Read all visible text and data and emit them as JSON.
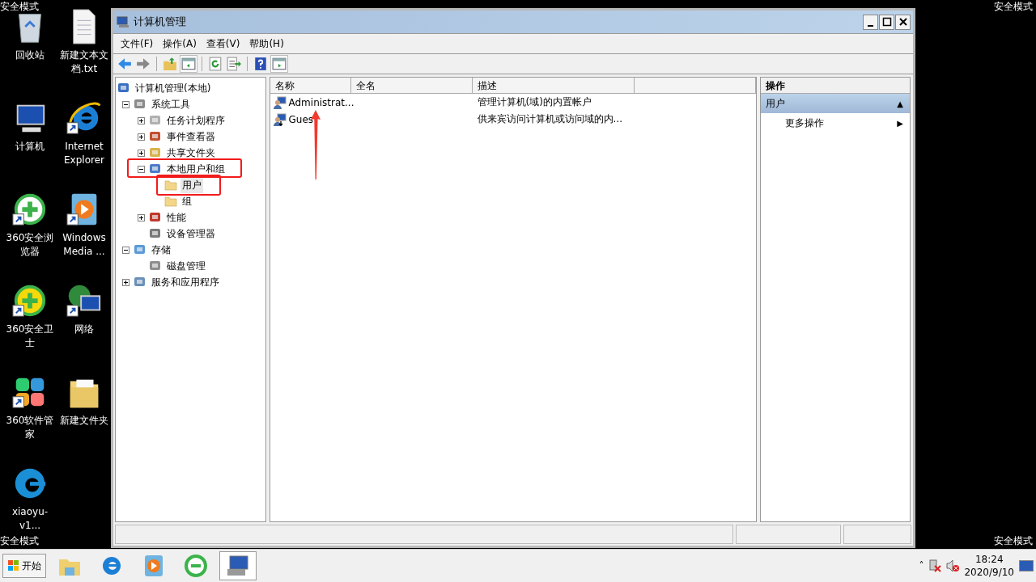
{
  "safe_mode_labels": [
    "安全模式",
    "安全模式",
    "安全模式",
    "安全模式"
  ],
  "desktop_icons": [
    {
      "label": "回收站",
      "kind": "recycle",
      "shortcut": false
    },
    {
      "label": "新建文本文档.txt",
      "kind": "document",
      "shortcut": false
    },
    {
      "label": "计算机",
      "kind": "computer",
      "shortcut": false
    },
    {
      "label": "Internet Explorer",
      "kind": "ie",
      "shortcut": true
    },
    {
      "label": "360安全浏览器",
      "kind": "browser360",
      "shortcut": true
    },
    {
      "label": "Windows Media ...",
      "kind": "media",
      "shortcut": true
    },
    {
      "label": "360安全卫士",
      "kind": "guard360",
      "shortcut": true
    },
    {
      "label": "网络",
      "kind": "network",
      "shortcut": true
    },
    {
      "label": "360软件管家",
      "kind": "soft360",
      "shortcut": true
    },
    {
      "label": "新建文件夹",
      "kind": "folder",
      "shortcut": false
    },
    {
      "label": "xiaoyu-v1...",
      "kind": "edge",
      "shortcut": false
    }
  ],
  "window": {
    "title": "计算机管理",
    "menu": [
      "文件(F)",
      "操作(A)",
      "查看(V)",
      "帮助(H)"
    ],
    "tree": [
      {
        "label": "计算机管理(本地)",
        "kind": "computer",
        "selected": false,
        "children": [
          {
            "label": "系统工具",
            "kind": "tools",
            "expanded": true,
            "selected": false,
            "children": [
              {
                "label": "任务计划程序",
                "kind": "clock",
                "expanded": false,
                "selected": false
              },
              {
                "label": "事件查看器",
                "kind": "event",
                "expanded": false,
                "selected": false
              },
              {
                "label": "共享文件夹",
                "kind": "share",
                "expanded": false,
                "selected": false
              },
              {
                "label": "本地用户和组",
                "kind": "users",
                "expanded": true,
                "selected": false,
                "children": [
                  {
                    "label": "用户",
                    "kind": "folder",
                    "selected": true
                  },
                  {
                    "label": "组",
                    "kind": "folder",
                    "selected": false
                  }
                ]
              },
              {
                "label": "性能",
                "kind": "perf",
                "expanded": false,
                "selected": false
              },
              {
                "label": "设备管理器",
                "kind": "device",
                "selected": false
              }
            ]
          },
          {
            "label": "存储",
            "kind": "storage",
            "expanded": true,
            "selected": false,
            "children": [
              {
                "label": "磁盘管理",
                "kind": "disk",
                "selected": false
              }
            ]
          },
          {
            "label": "服务和应用程序",
            "kind": "services",
            "expanded": false,
            "selected": false
          }
        ]
      }
    ],
    "columns": [
      "名称",
      "全名",
      "描述"
    ],
    "rows": [
      {
        "name": "Administrat...",
        "description": "管理计算机(域)的内置帐户",
        "kind": "admin"
      },
      {
        "name": "Gues",
        "description": "供来宾访问计算机或访问域的内...",
        "kind": "guest"
      }
    ],
    "actions": {
      "header": "操作",
      "section": {
        "label": "用户",
        "expanded": true,
        "toggle": "▲"
      },
      "items": [
        {
          "label": "更多操作",
          "arrow": "▶"
        }
      ]
    }
  },
  "taskbar": {
    "start": "开始",
    "apps": [
      {
        "kind": "explorer",
        "active": false
      },
      {
        "kind": "ie",
        "active": false
      },
      {
        "kind": "media",
        "active": false
      },
      {
        "kind": "browser360",
        "active": false
      },
      {
        "kind": "mmc",
        "active": true
      }
    ],
    "tray_chevron": "˄",
    "time": "18:24",
    "date": "2020/9/10"
  }
}
